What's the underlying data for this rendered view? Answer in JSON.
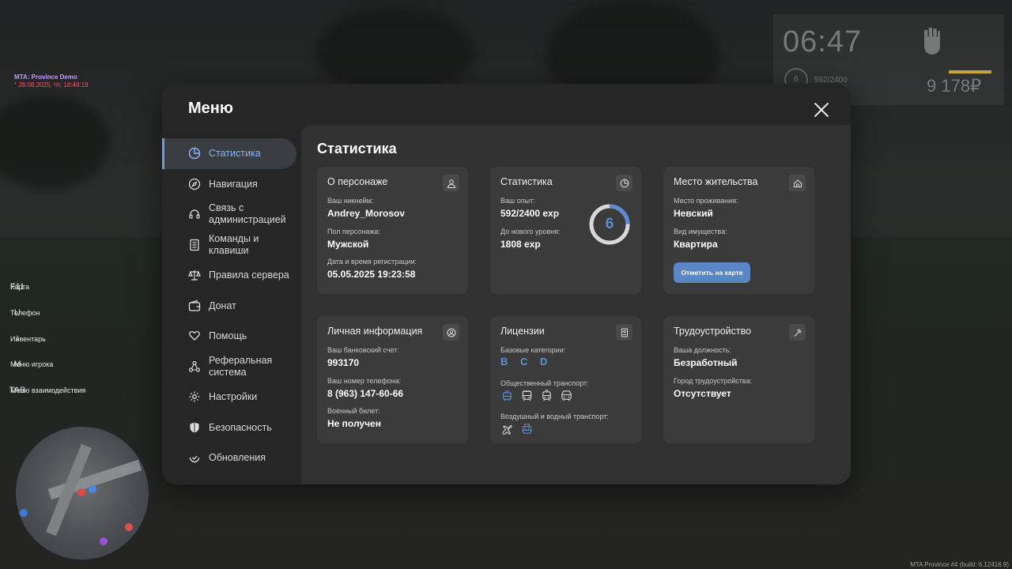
{
  "hud": {
    "mta_title": "MTA: Province Demo",
    "mta_date": "* 28.08.2025, Чт, 18:48:19",
    "clock": "06:47",
    "level": "6",
    "exp": "592/2400",
    "money": "9 178₽",
    "build": "MTA Province #4 (build: 6.12416.9)"
  },
  "hotkeys": [
    {
      "key": "F11",
      "label": "Карта"
    },
    {
      "key": "U",
      "label": "Телефон"
    },
    {
      "key": "I",
      "label": "Инвентарь"
    },
    {
      "key": "M",
      "label": "Меню игрока"
    },
    {
      "key": "TAB",
      "label": "Меню взаимодействия"
    }
  ],
  "menu": {
    "title": "Меню",
    "sidebar": [
      {
        "label": "Статистика",
        "icon": "pie-chart-icon"
      },
      {
        "label": "Навигация",
        "icon": "compass-icon"
      },
      {
        "label": "Связь с администрацией",
        "icon": "headset-icon"
      },
      {
        "label": "Команды и клавиши",
        "icon": "list-icon"
      },
      {
        "label": "Правила сервера",
        "icon": "scales-icon"
      },
      {
        "label": "Донат",
        "icon": "wallet-icon"
      },
      {
        "label": "Помощь",
        "icon": "heart-hand-icon"
      },
      {
        "label": "Реферальная система",
        "icon": "network-icon"
      },
      {
        "label": "Настройки",
        "icon": "gear-icon"
      },
      {
        "label": "Безопасность",
        "icon": "shield-icon"
      },
      {
        "label": "Обновления",
        "icon": "refresh-icon"
      }
    ],
    "section_title": "Статистика",
    "cards": {
      "character": {
        "title": "О персонаже",
        "nickname_label": "Ваш никнейм:",
        "nickname": "Andrey_Morosov",
        "gender_label": "Пол персонажа:",
        "gender": "Мужской",
        "reg_label": "Дата и время регистрации:",
        "reg": "05.05.2025 19:23:58"
      },
      "stats": {
        "title": "Статистика",
        "exp_label": "Ваш опыт:",
        "exp": "592/2400 exp",
        "next_label": "До нового уровня:",
        "next": "1808 exp",
        "level": "6",
        "progress": 0.2467
      },
      "residence": {
        "title": "Место жительства",
        "place_label": "Место проживания:",
        "place": "Невский",
        "property_label": "Вид имущества:",
        "property": "Квартира",
        "button": "Отметить на карте"
      },
      "personal": {
        "title": "Личная информация",
        "bank_label": "Ваш банковский счет:",
        "bank": "993170",
        "phone_label": "Ваш номер телефона:",
        "phone": "8 (963) 147-60-66",
        "military_label": "Военный билет:",
        "military": "Не получен"
      },
      "licenses": {
        "title": "Лицензии",
        "base_label": "Базовые категории:",
        "base": "B C D",
        "public_label": "Общественный транспорт:",
        "air_label": "Воздушный и водный транспорт:"
      },
      "employment": {
        "title": "Трудоустройство",
        "position_label": "Ваша должность:",
        "position": "Безработный",
        "city_label": "Город трудоустройства:",
        "city": "Отсутствует"
      }
    }
  },
  "colors": {
    "accent": "#5a86c6",
    "active_text": "#8ab4f8",
    "card": "#3b3b3b",
    "panel": "#262626"
  }
}
